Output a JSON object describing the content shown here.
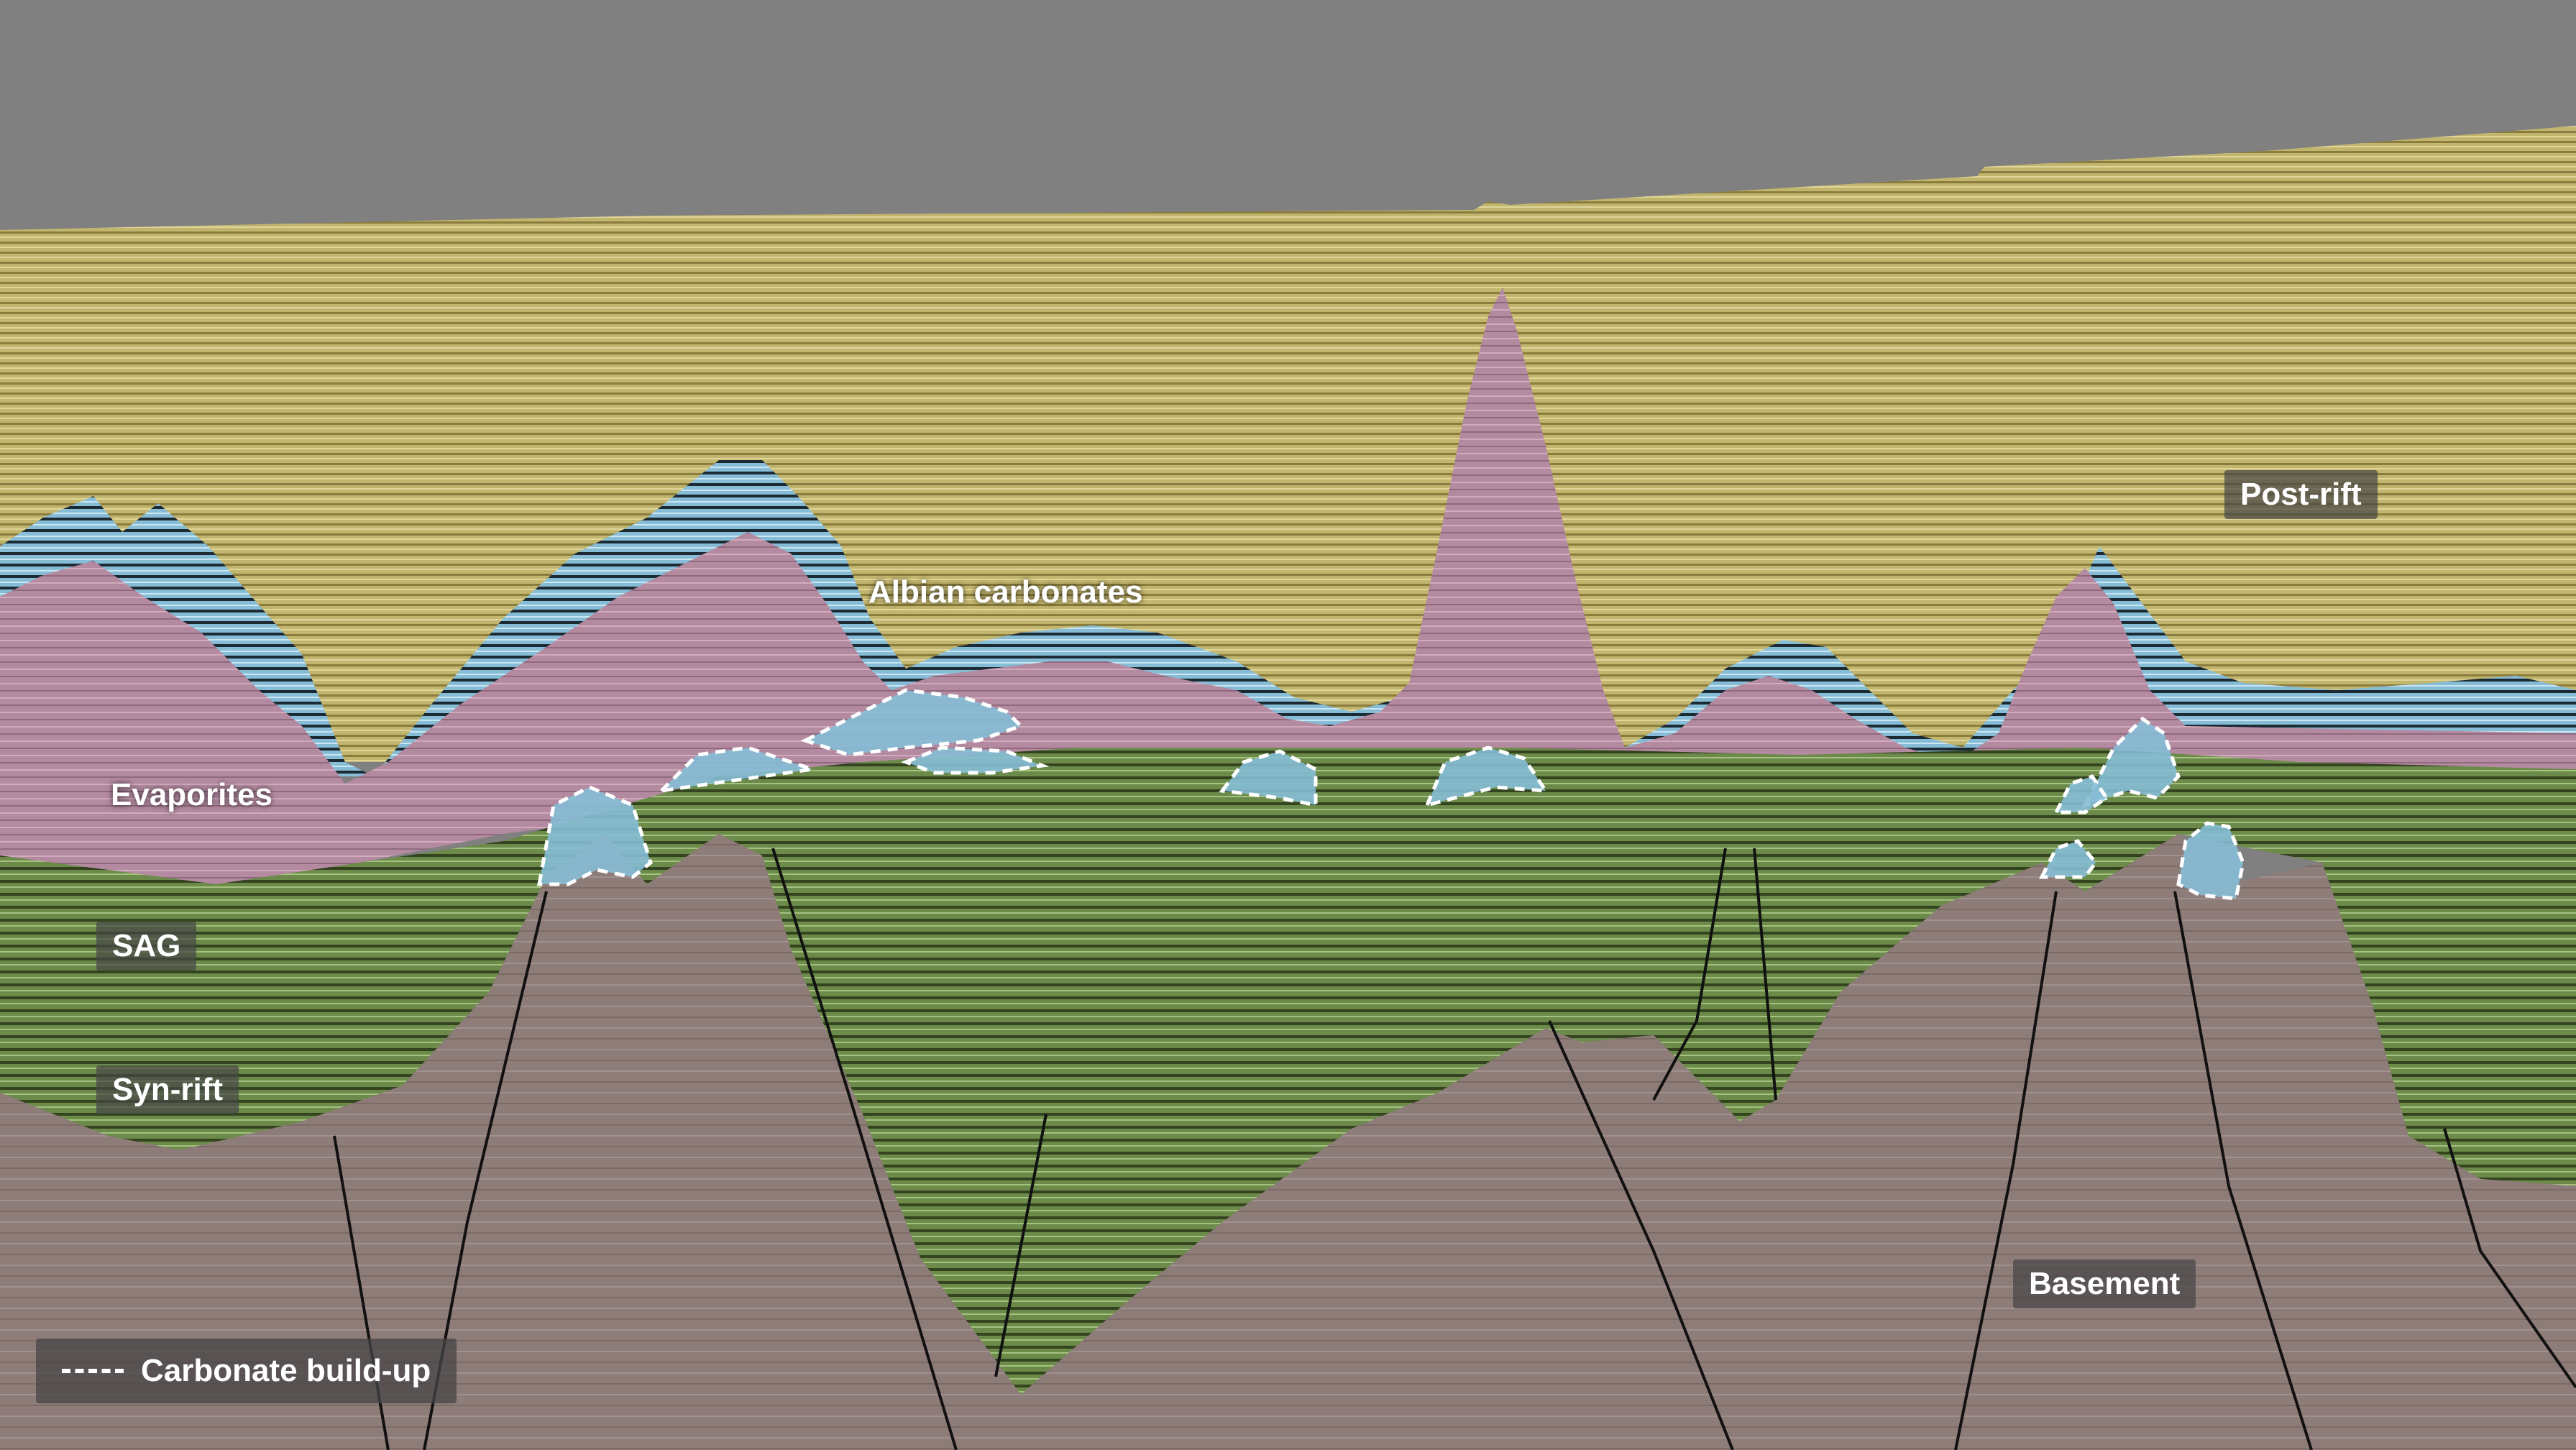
{
  "colors": {
    "sky": "#808080",
    "post_rift": "#c2b56e",
    "albian_carbonates": "#86bcd6",
    "evaporites": "#b48aa0",
    "sag_synrift": "#6c8a4a",
    "basement": "#8e7c78",
    "fault_line": "#111111",
    "buildup_outline": "#ffffff",
    "label_bg": "#505050",
    "label_text": "#ffffff"
  },
  "labels": {
    "post_rift": "Post-rift",
    "albian_carbonates": "Albian carbonates",
    "evaporites": "Evaporites",
    "sag": "SAG",
    "syn_rift": "Syn-rift",
    "basement": "Basement"
  },
  "legend": {
    "icon": "dashed-line-icon",
    "text": "Carbonate build-up"
  }
}
